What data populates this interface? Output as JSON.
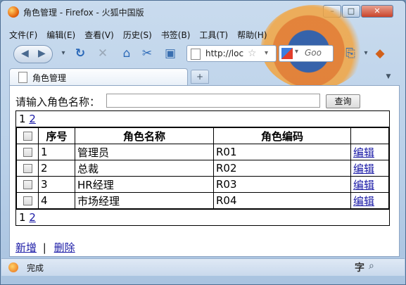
{
  "window": {
    "title": "角色管理 - Firefox - 火狐中国版",
    "minimize": "–",
    "maximize": "□",
    "close": "✕"
  },
  "menu": [
    "文件(F)",
    "编辑(E)",
    "查看(V)",
    "历史(S)",
    "书签(B)",
    "工具(T)",
    "帮助(H)"
  ],
  "toolbar": {
    "url": "http://loc",
    "search_placeholder": "Goo"
  },
  "tab": {
    "label": "角色管理",
    "new_tab": "+"
  },
  "page": {
    "search_label": "请输入角色名称：",
    "search_value": "",
    "query_button": "查询",
    "pager": [
      "1",
      "2"
    ],
    "headers": [
      "序号",
      "角色名称",
      "角色编码"
    ],
    "rows": [
      {
        "seq": "1",
        "name": "管理员",
        "code": "R01",
        "action": "编辑"
      },
      {
        "seq": "2",
        "name": "总裁",
        "code": "R02",
        "action": "编辑"
      },
      {
        "seq": "3",
        "name": "HR经理",
        "code": "R03",
        "action": "编辑"
      },
      {
        "seq": "4",
        "name": "市场经理",
        "code": "R04",
        "action": "编辑"
      }
    ],
    "add_link": "新增",
    "separator": "|",
    "delete_link": "删除"
  },
  "status": {
    "text": "完成",
    "zi": "字"
  }
}
